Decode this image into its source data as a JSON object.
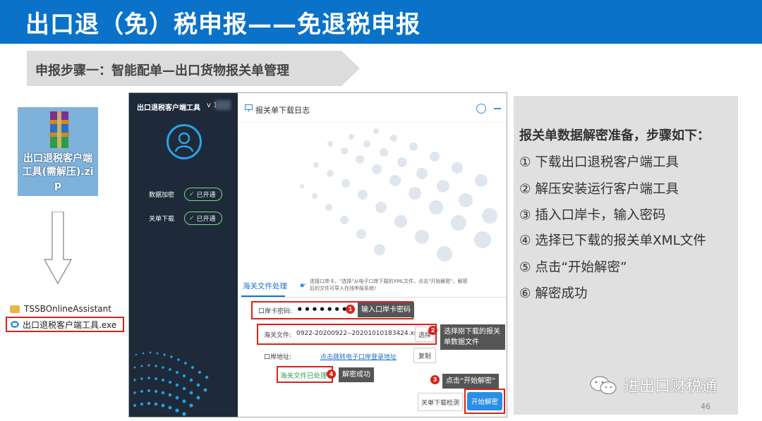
{
  "header": {
    "title": "出口退（免）税申报——免退税申报"
  },
  "step": {
    "label": "申报步骤一：智能配单—出口货物报关单管理"
  },
  "zip_file": {
    "label": "出口退税客户端工具(需解压).zip"
  },
  "file_list": [
    {
      "name": "TSSBOnlineAssistant",
      "icon": "folder-icon"
    },
    {
      "name": "出口退税客户端工具.exe",
      "icon": "exe-icon"
    }
  ],
  "app": {
    "title": "出口退税客户端工具",
    "version": "v 1",
    "status": [
      {
        "label": "数据加密",
        "value": "已开通"
      },
      {
        "label": "关单下载",
        "value": "已开通"
      }
    ],
    "log_title": "报关单下载日志",
    "tab": "海关文件处理",
    "hint": "连接口岸卡，\"选择\"从电子口岸下载的XML文件，点击\"开始解密\"，解密后的文件可导入在线申报系统!",
    "form": {
      "password_label": "口岸卡密码:",
      "password_value": "••••••••",
      "file_label": "海关文件:",
      "file_value": "0922-20200922--20201010183424.xml",
      "select_button": "选择",
      "address_label": "口岸地址:",
      "address_link": "点击跳转电子口岸登录地址",
      "copy_button": "复制",
      "result": "海关文件已处理!",
      "detect_button": "关单下载检测",
      "decrypt_button": "开始解密"
    },
    "callouts": [
      {
        "num": "1",
        "text": "输入口岸卡密码"
      },
      {
        "num": "2",
        "text": "选择刚下载的报关单数据文件"
      },
      {
        "num": "3",
        "text": "点击“开始解密”"
      },
      {
        "num": "4",
        "text": "解密成功"
      }
    ]
  },
  "panel": {
    "title": "报关单数据解密准备，步骤如下：",
    "steps": [
      "① 下载出口退税客户端工具",
      "② 解压安装运行客户端工具",
      "③ 插入口岸卡，输入密码",
      "④ 选择已下载的报关单XML文件",
      "⑤ 点击“开始解密”",
      "⑥ 解密成功"
    ],
    "page": "46"
  },
  "watermark": {
    "text": "进出口财税通"
  },
  "colors": {
    "header": "#0a72c9",
    "accent": "#2a8ee6",
    "highlight": "#d9241c",
    "success": "#2aa34a"
  }
}
